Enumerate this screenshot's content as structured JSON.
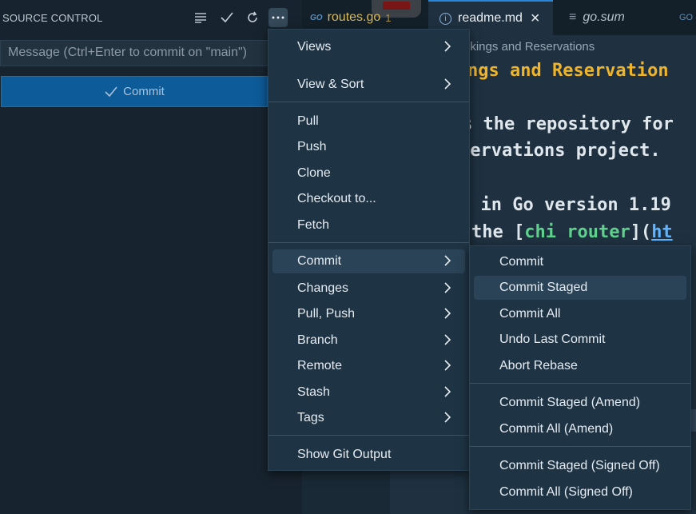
{
  "source_control": {
    "title": "SOURCE CONTROL",
    "icons": [
      "list-icon",
      "check-icon",
      "refresh-icon",
      "more-icon"
    ],
    "message_placeholder": "Message (Ctrl+Enter to commit on \"main\")",
    "commit_label": "Commit"
  },
  "tabs": [
    {
      "label": "routes.go",
      "badge": "1",
      "icon": "go-icon"
    },
    {
      "label": "readme.md",
      "icon": "info-icon",
      "close": "×"
    },
    {
      "label": "go.sum",
      "icon": "lines-icon"
    }
  ],
  "editor": {
    "breadcrumb": "okings and Reservations",
    "heading": "ngs and Reservation",
    "line1": "s the repository for",
    "line2": "servations project.",
    "line3_a": "t in Go version 1.19",
    "line4_a": "the [",
    "line4_link": "chi router",
    "line4_b": "](",
    "line4_url": "ht"
  },
  "main_menu": {
    "group1": [
      "Views",
      "View & Sort"
    ],
    "group2": [
      "Pull",
      "Push",
      "Clone",
      "Checkout to...",
      "Fetch"
    ],
    "group3": [
      "Commit",
      "Changes",
      "Pull, Push",
      "Branch",
      "Remote",
      "Stash",
      "Tags"
    ],
    "group4": [
      "Show Git Output"
    ]
  },
  "commit_submenu": {
    "group1": [
      "Commit",
      "Commit Staged",
      "Commit All",
      "Undo Last Commit",
      "Abort Rebase"
    ],
    "group2": [
      "Commit Staged (Amend)",
      "Commit All (Amend)"
    ],
    "group3": [
      "Commit Staged (Signed Off)",
      "Commit All (Signed Off)"
    ]
  },
  "colors": {
    "accent": "#0e5b99",
    "heading": "#f0b429",
    "link": "#5fd18c"
  }
}
